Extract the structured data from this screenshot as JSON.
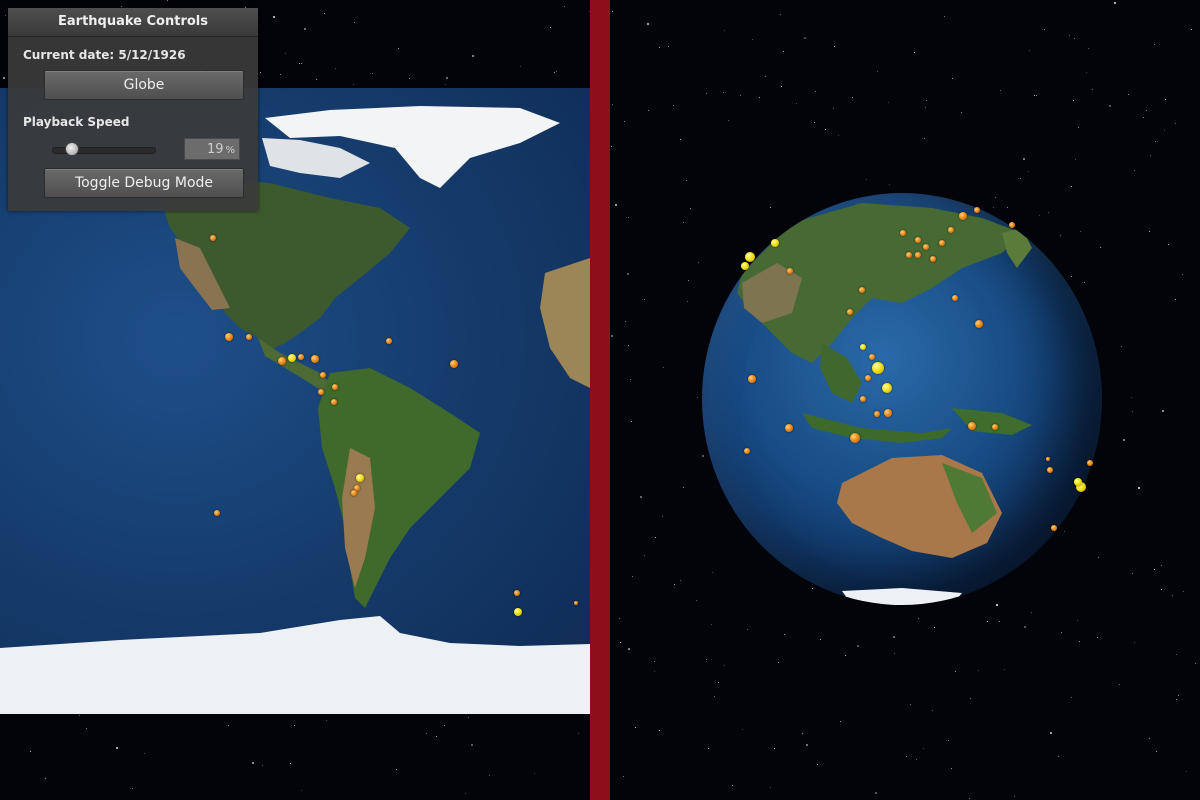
{
  "panel": {
    "title": "Earthquake Controls",
    "current_date_label": "Current date:",
    "current_date_value": "5/12/1926",
    "view_button_label": "Globe",
    "playback_speed_label": "Playback Speed",
    "playback_speed_value": "19",
    "playback_speed_unit": "%",
    "debug_button_label": "Toggle Debug Mode"
  },
  "colors": {
    "divider": "#8e0e1b",
    "quake_orange": "#f08c1c",
    "quake_yellow": "#f3e11b",
    "ocean": "#174a82"
  }
}
